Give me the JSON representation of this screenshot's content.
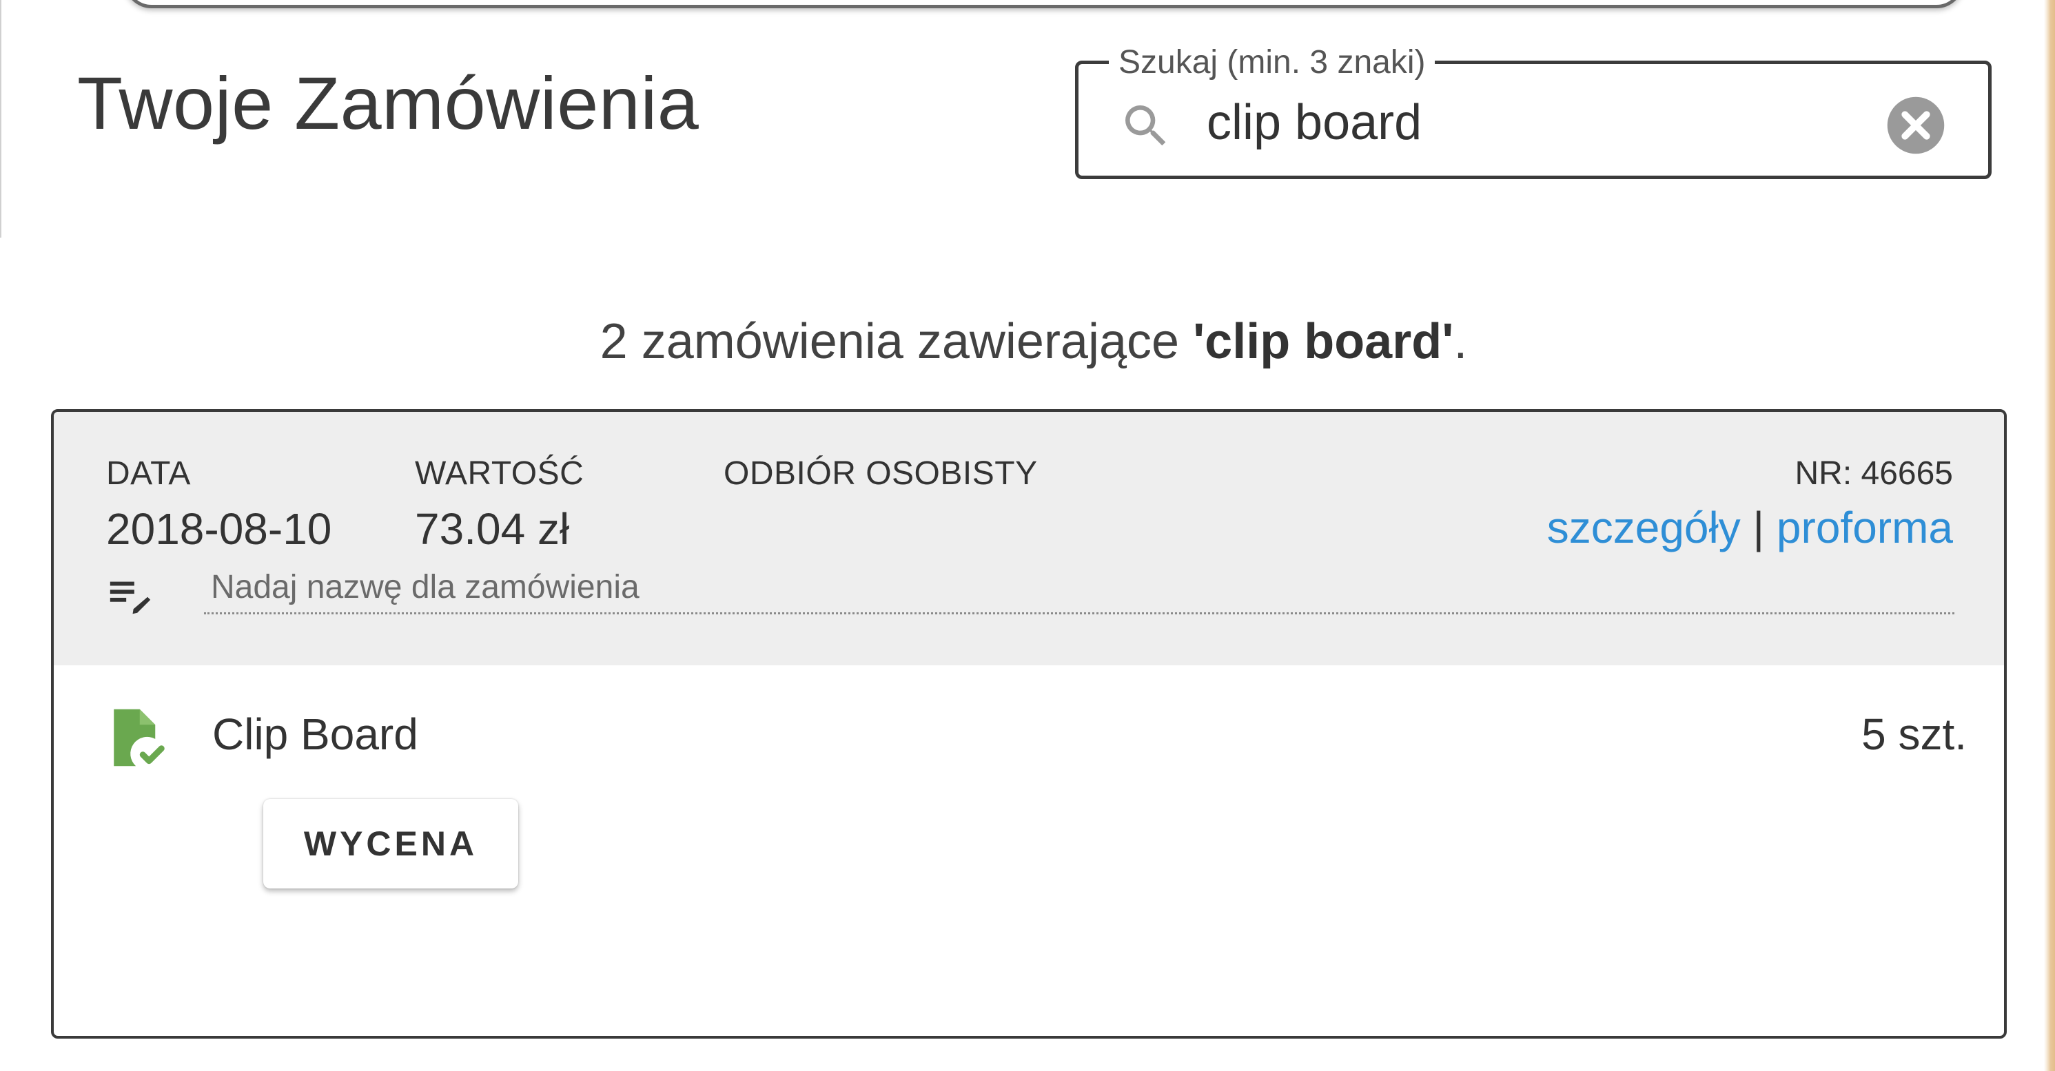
{
  "page": {
    "title": "Twoje Zamówienia"
  },
  "search": {
    "label": "Szukaj (min. 3 znaki)",
    "value": "clip board",
    "icon": "search-icon",
    "clear_icon": "close-circle-icon"
  },
  "results": {
    "summary_prefix": "2 zamówienia zawierające ",
    "query": "'clip board'",
    "summary_suffix": "."
  },
  "order": {
    "date_label": "DATA",
    "date_value": "2018-08-10",
    "value_label": "WARTOŚĆ",
    "value_value": "73.04 zł",
    "delivery_label": "ODBIÓR OSOBISTY",
    "number": "NR: 46665",
    "details_link": "szczegóły",
    "link_separator": " | ",
    "proforma_link": "proforma",
    "name_placeholder": "Nadaj nazwę dla zamówienia",
    "rename_icon": "edit-note-icon",
    "items": [
      {
        "icon": "document-check-icon",
        "name": "Clip Board",
        "quantity": "5 szt.",
        "action_label": "WYCENA"
      }
    ]
  },
  "colors": {
    "link": "#2e8ed6",
    "header_bg": "#eeeeee",
    "item_icon": "#6aa84f",
    "border": "#3a3a3a"
  }
}
